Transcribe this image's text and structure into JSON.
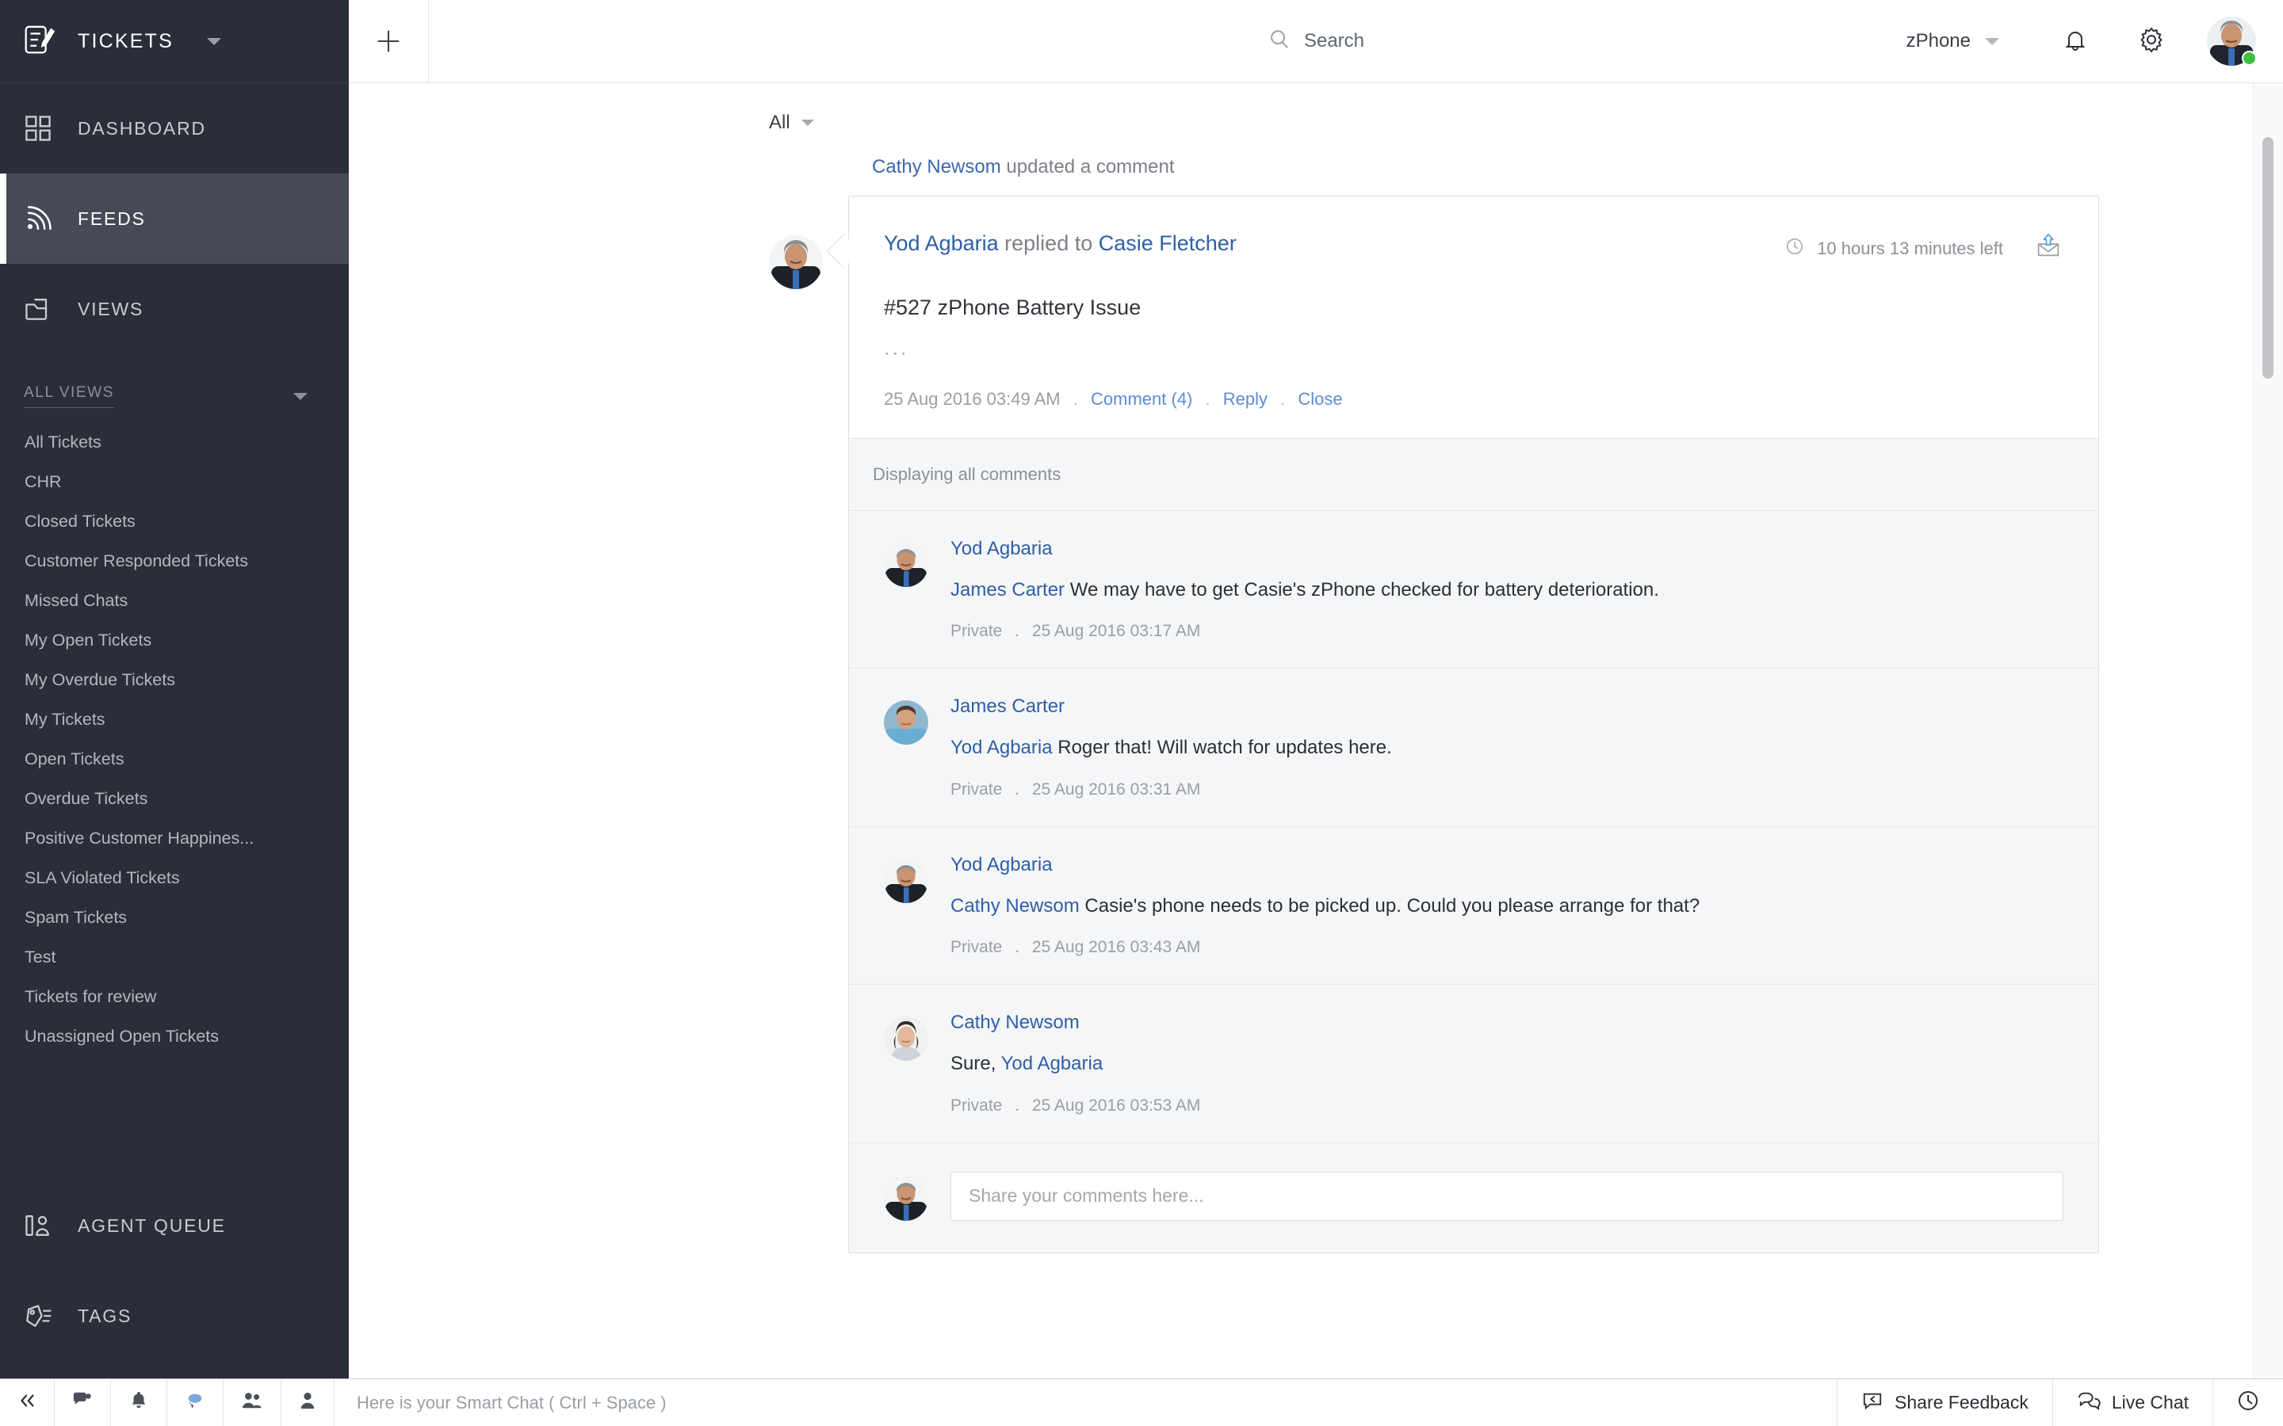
{
  "sidebar": {
    "brand": {
      "title": "TICKETS",
      "icon": "ticket-compose-icon"
    },
    "nav": [
      {
        "label": "DASHBOARD",
        "icon": "dashboard-grid-icon",
        "active": false
      },
      {
        "label": "FEEDS",
        "icon": "feed-rss-icon",
        "active": true
      },
      {
        "label": "VIEWS",
        "icon": "views-folder-icon",
        "active": false
      }
    ],
    "views_header": "ALL VIEWS",
    "views": [
      "All Tickets",
      "CHR",
      "Closed Tickets",
      "Customer Responded Tickets",
      "Missed Chats",
      "My Open Tickets",
      "My Overdue Tickets",
      "My Tickets",
      "Open Tickets",
      "Overdue Tickets",
      "Positive Customer Happines...",
      "SLA Violated Tickets",
      "Spam Tickets",
      "Test",
      "Tickets for review",
      "Unassigned Open Tickets"
    ],
    "bottom_nav": [
      {
        "label": "AGENT QUEUE",
        "icon": "agent-queue-icon"
      },
      {
        "label": "TAGS",
        "icon": "tag-icon"
      }
    ]
  },
  "topbar": {
    "add_icon": "plus-icon",
    "search_placeholder": "Search",
    "search_icon": "search-icon",
    "department": "zPhone",
    "notifications_icon": "bell-icon",
    "settings_icon": "gear-icon",
    "avatar": "user-avatar",
    "presence": "online"
  },
  "content": {
    "filter": {
      "label": "All",
      "icon": "chevron-down-icon"
    },
    "feed": {
      "meta_actor": "Cathy Newsom",
      "meta_action": "updated a comment",
      "card": {
        "actor": "Yod Agbaria",
        "action": "replied to",
        "recipient": "Casie Fletcher",
        "sla_icon": "clock-icon",
        "sla_text": "10 hours 13 minutes left",
        "channel_icon": "email-outgoing-icon",
        "subject": "#527 zPhone Battery Issue",
        "more": "...",
        "timestamp": "25 Aug 2016 03:49 AM",
        "actions": [
          "Comment (4)",
          "Reply",
          "Close"
        ]
      },
      "comments_header": "Displaying all comments",
      "comments": [
        {
          "author": "Yod Agbaria",
          "mention": "James Carter",
          "text": "We may have to get Casie's zPhone checked for battery deterioration.",
          "visibility": "Private",
          "timestamp": "25 Aug 2016 03:17 AM"
        },
        {
          "author": "James Carter",
          "mention": "Yod Agbaria",
          "text": "Roger that! Will watch for updates here.",
          "visibility": "Private",
          "timestamp": "25 Aug 2016 03:31 AM"
        },
        {
          "author": "Yod Agbaria",
          "mention": "Cathy Newsom",
          "text": "Casie's phone needs to be picked up. Could you please arrange for that?",
          "visibility": "Private",
          "timestamp": "25 Aug 2016 03:43 AM"
        },
        {
          "author": "Cathy Newsom",
          "prefix": "Sure,",
          "mention": "Yod Agbaria",
          "text": "",
          "visibility": "Private",
          "timestamp": "25 Aug 2016 03:53 AM"
        }
      ],
      "compose_placeholder": "Share your comments here..."
    }
  },
  "statusbar": {
    "collapse_icon": "double-chevron-left-icon",
    "icons": [
      "chat-settings-icon",
      "bell-icon",
      "chat-bubble-icon",
      "group-icon",
      "person-icon"
    ],
    "smart_chat_hint": "Here is your Smart Chat ( Ctrl + Space )",
    "share_feedback": {
      "label": "Share Feedback",
      "icon": "feedback-icon"
    },
    "live_chat": {
      "label": "Live Chat",
      "icon": "live-chat-icon"
    },
    "history_icon": "clock-icon"
  },
  "colors": {
    "sidebar_bg": "#2a2e38",
    "sidebar_active": "#464a57",
    "link": "#2e5fa8",
    "action_link": "#5d8bd6",
    "presence_green": "#3ec13e",
    "accent_blue": "#4a9fe0"
  }
}
